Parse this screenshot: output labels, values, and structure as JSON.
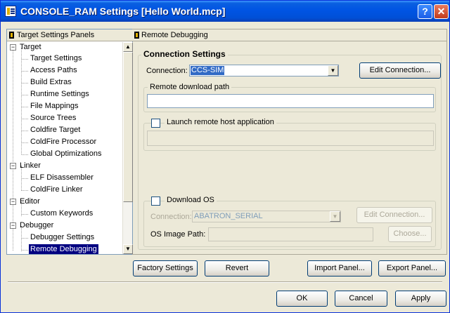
{
  "window": {
    "title": "CONSOLE_RAM Settings [Hello World.mcp]",
    "help_label": "?",
    "close_label": "✕"
  },
  "tree": {
    "header": "Target Settings Panels",
    "items": [
      {
        "label": "Target",
        "level": 0,
        "expanded": true
      },
      {
        "label": "Target Settings",
        "level": 1
      },
      {
        "label": "Access Paths",
        "level": 1
      },
      {
        "label": "Build Extras",
        "level": 1
      },
      {
        "label": "Runtime Settings",
        "level": 1
      },
      {
        "label": "File Mappings",
        "level": 1
      },
      {
        "label": "Source Trees",
        "level": 1
      },
      {
        "label": "Coldfire Target",
        "level": 1
      },
      {
        "label": "ColdFire Processor",
        "level": 1
      },
      {
        "label": "Global Optimizations",
        "level": 1
      },
      {
        "label": "Linker",
        "level": 0,
        "expanded": true
      },
      {
        "label": "ELF Disassembler",
        "level": 1
      },
      {
        "label": "ColdFire Linker",
        "level": 1
      },
      {
        "label": "Editor",
        "level": 0,
        "expanded": true
      },
      {
        "label": "Custom Keywords",
        "level": 1
      },
      {
        "label": "Debugger",
        "level": 0,
        "expanded": true
      },
      {
        "label": "Debugger Settings",
        "level": 1
      },
      {
        "label": "Remote Debugging",
        "level": 1,
        "selected": true
      }
    ],
    "expand_glyph": "−",
    "scroll_up": "▲",
    "scroll_down": "▼"
  },
  "panel": {
    "header": "Remote Debugging",
    "connection_settings": {
      "title": "Connection Settings",
      "connection_label": "Connection:",
      "connection_value": "CCS-SIM",
      "edit_connection": "Edit Connection...",
      "remote_download_path": {
        "title": "Remote download path",
        "value": ""
      },
      "launch_remote_host": {
        "label": "Launch remote host application",
        "checked": false,
        "value": ""
      },
      "download_os": {
        "label": "Download OS",
        "checked": false,
        "connection_label": "Connection:",
        "connection_value": "ABATRON_SERIAL",
        "edit_connection": "Edit Connection...",
        "os_image_path_label": "OS Image Path:",
        "os_image_path_value": "",
        "choose": "Choose..."
      }
    },
    "combo_arrow": "▼"
  },
  "panel_buttons": {
    "factory_settings": "Factory Settings",
    "revert": "Revert",
    "import_panel": "Import Panel...",
    "export_panel": "Export Panel..."
  },
  "dialog_buttons": {
    "ok": "OK",
    "cancel": "Cancel",
    "apply": "Apply"
  }
}
